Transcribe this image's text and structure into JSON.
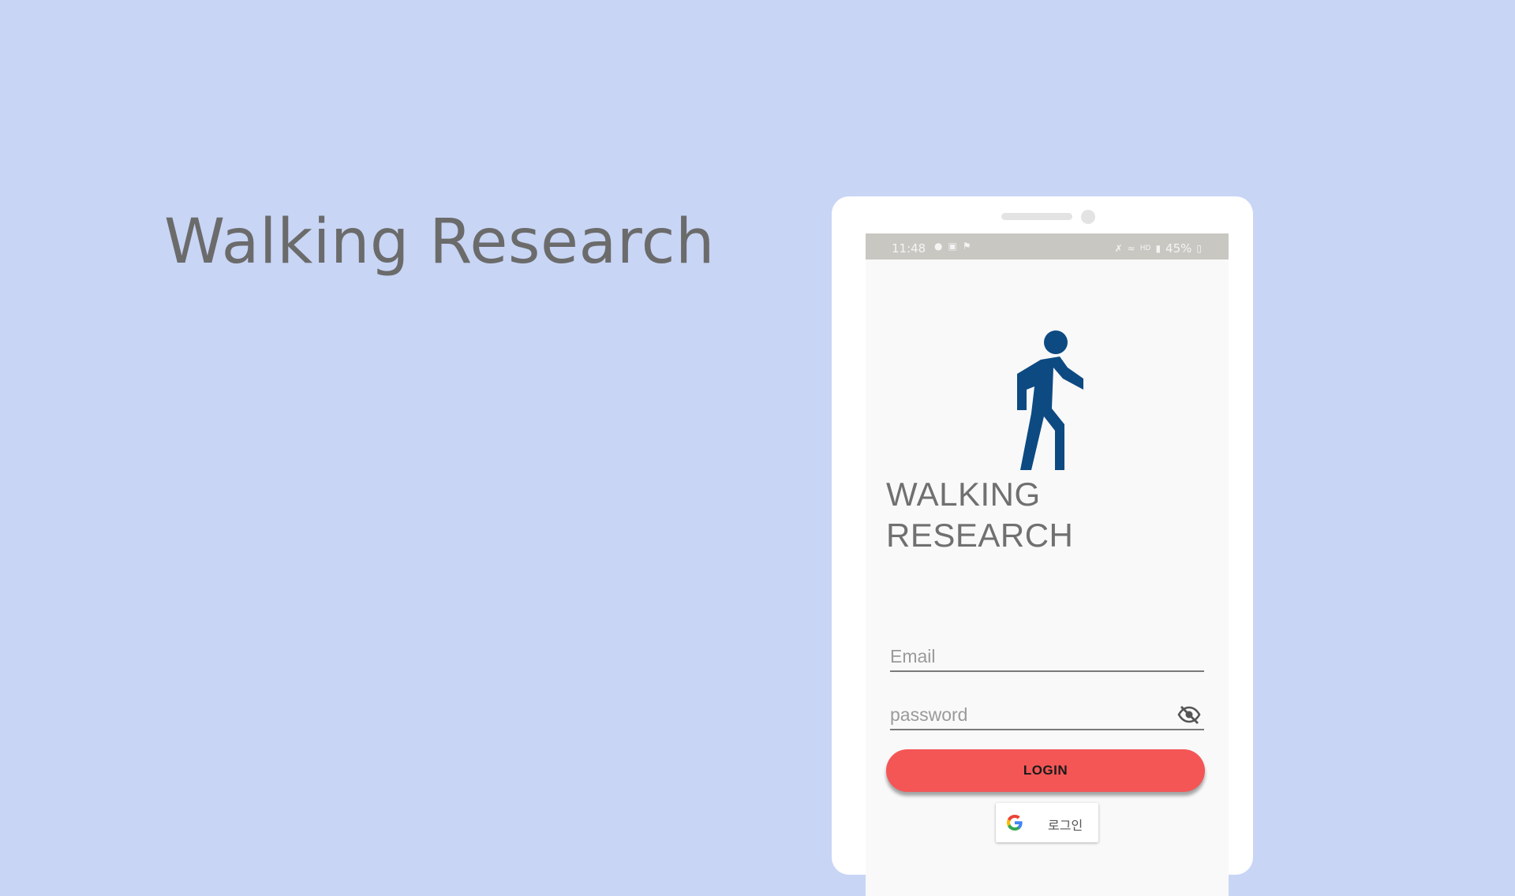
{
  "slide": {
    "title": "Walking Research"
  },
  "status_bar": {
    "time": "11:48",
    "left_icons": [
      "message-icon",
      "photo-icon",
      "app-icon"
    ],
    "right_icons": [
      "mute-icon",
      "wifi-icon",
      "hd-icon",
      "signal-icon"
    ],
    "battery": "45%"
  },
  "app": {
    "logo_icon": "walking-person-icon",
    "title_line1": "WALKING",
    "title_line2": "RESEARCH",
    "email_placeholder": "Email",
    "password_placeholder": "password",
    "password_toggle_icon": "eye-off-icon",
    "login_label": "LOGIN",
    "google_label": "로그인",
    "google_icon": "google-g-icon"
  },
  "colors": {
    "background": "#c8d5f5",
    "logo": "#0d4a82",
    "login_button": "#f45656",
    "status_bar": "#c9c7c2"
  }
}
